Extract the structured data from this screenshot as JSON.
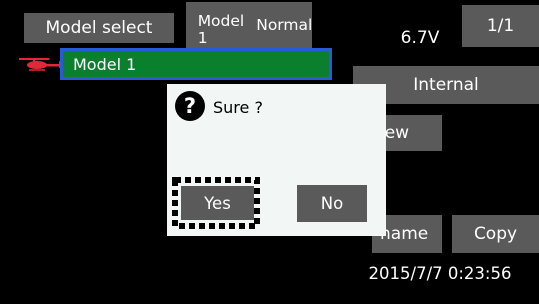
{
  "header": {
    "title": "Model select",
    "model_name": "Model 1",
    "model_type": "Normal",
    "voltage": "6.7V",
    "page": "1/1"
  },
  "model_list": {
    "items": [
      {
        "name": "Model 1",
        "icon": "helicopter-icon",
        "selected": true
      }
    ]
  },
  "buttons": {
    "internal": "Internal",
    "new": "New",
    "rename": "Rename",
    "copy": "Copy"
  },
  "visible_partial": {
    "new": "lew",
    "rename": "name"
  },
  "dialog": {
    "icon": "question-icon",
    "message": "Sure ?",
    "yes": "Yes",
    "no": "No"
  },
  "status": {
    "datetime": "2015/7/7 0:23:56"
  },
  "colors": {
    "background": "#000000",
    "button": "#5a5a5a",
    "selected_item": "#0a7f2e",
    "selection_border": "#2a5bd7",
    "dialog_bg": "#f2f7f5",
    "heli": "#e0283a"
  }
}
